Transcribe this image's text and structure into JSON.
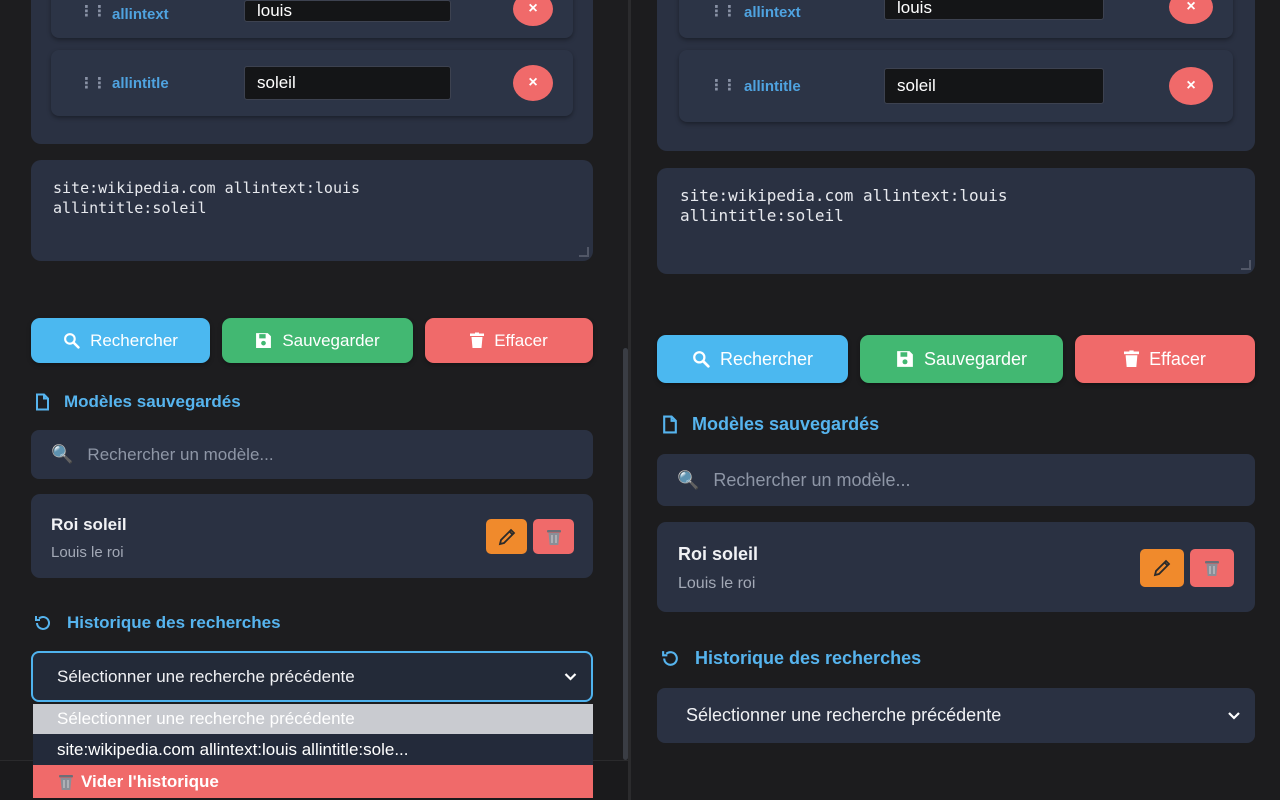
{
  "operators": [
    {
      "label": "allintext",
      "value": "louis"
    },
    {
      "label": "allintitle",
      "value": "soleil"
    }
  ],
  "remove_symbol": "×",
  "query": "site:wikipedia.com allintext:louis\nallintitle:soleil",
  "actions": {
    "search_label": "Rechercher",
    "save_label": "Sauvegarder",
    "clear_label": "Effacer"
  },
  "models": {
    "title": "Modèles sauvegardés",
    "search_placeholder": "Rechercher un modèle...",
    "items": [
      {
        "name": "Roi soleil",
        "description": "Louis le roi"
      }
    ]
  },
  "history": {
    "title": "Historique des recherches",
    "selected": "Sélectionner une recherche précédente",
    "options": [
      "Sélectionner une recherche précédente",
      "site:wikipedia.com allintext:louis allintitle:sole...",
      "Vider l'historique"
    ]
  },
  "icons": {
    "drag": "drag-handle-icon",
    "remove": "close-icon",
    "search": "magnifier-icon",
    "save": "floppy-disk-icon",
    "clear": "trash-icon",
    "models": "document-icon",
    "history": "history-icon",
    "edit": "pencil-icon",
    "delete": "trash-can-icon",
    "chevron": "chevron-down-icon"
  },
  "colors": {
    "accent": "#56b4ee",
    "search_button": "#4bb8f0",
    "save_button": "#42b872",
    "danger": "#f06a6a",
    "edit": "#f08a2c",
    "card": "#2a3142",
    "background": "#1c1c1e"
  }
}
